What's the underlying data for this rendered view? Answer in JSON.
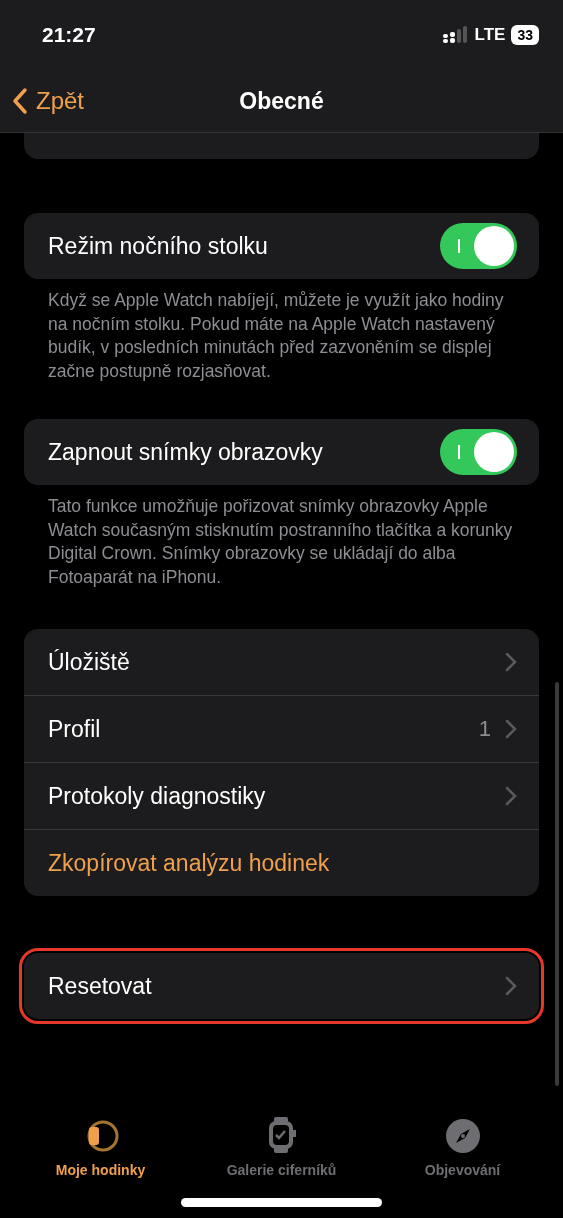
{
  "status_bar": {
    "time": "21:27",
    "network": "LTE",
    "battery": "33"
  },
  "nav": {
    "back": "Zpět",
    "title": "Obecné"
  },
  "toggles": [
    {
      "label": "Režim nočního stolku",
      "on": true,
      "footer": "Když se Apple Watch nabíjejí, můžete je využít jako hodiny na nočním stolku. Pokud máte na Apple Watch nastavený budík, v posledních minutách před zazvoněním se displej začne postupně rozjasňovat."
    },
    {
      "label": "Zapnout snímky obrazovky",
      "on": true,
      "footer": "Tato funkce umožňuje pořizovat snímky obrazovky Apple Watch současným stisknutím postranního tlačítka a korunky Digital Crown. Snímky obrazovky se ukládají do alba Fotoaparát na iPhonu."
    }
  ],
  "group": [
    {
      "kind": "link",
      "label": "Úložiště"
    },
    {
      "kind": "link",
      "label": "Profil",
      "value": "1"
    },
    {
      "kind": "link",
      "label": "Protokoly diagnostiky"
    },
    {
      "kind": "action",
      "label": "Zkopírovat analýzu hodinek"
    }
  ],
  "reset": {
    "label": "Resetovat",
    "highlighted": true
  },
  "tabs": [
    {
      "label": "Moje hodinky",
      "selected": true
    },
    {
      "label": "Galerie ciferníků",
      "selected": false
    },
    {
      "label": "Objevování",
      "selected": false
    }
  ]
}
